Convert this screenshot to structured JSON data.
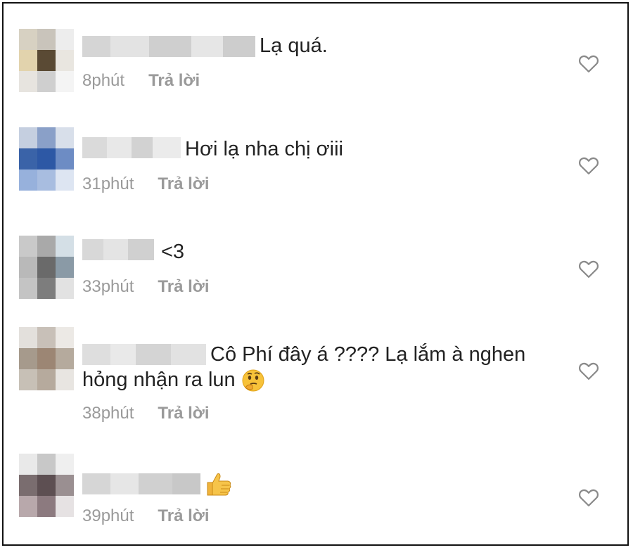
{
  "comments": [
    {
      "text_line1": "Lạ quá.",
      "text_line2": "",
      "time": "8phút",
      "reply": "Trả lời",
      "emoji": ""
    },
    {
      "text_line1": "Hơi lạ nha chị ơiii",
      "text_line2": "",
      "time": "31phút",
      "reply": "Trả lời",
      "emoji": ""
    },
    {
      "text_line1": "<3",
      "text_line2": "",
      "time": "33phút",
      "reply": "Trả lời",
      "emoji": ""
    },
    {
      "text_line1": "Cô Phí đây á ???? Lạ lắm à nghen",
      "text_line2": "hỏng nhận ra lun",
      "time": "38phút",
      "reply": "Trả lời",
      "emoji": "thinking-face"
    },
    {
      "text_line1": "",
      "text_line2": "",
      "time": "39phút",
      "reply": "Trả lời",
      "emoji": "thumbs-up"
    }
  ],
  "icons": {
    "like": "heart-outline-icon"
  },
  "colors": {
    "text": "#222222",
    "meta": "#9a9a9a",
    "heart": "#8a8a8a"
  }
}
